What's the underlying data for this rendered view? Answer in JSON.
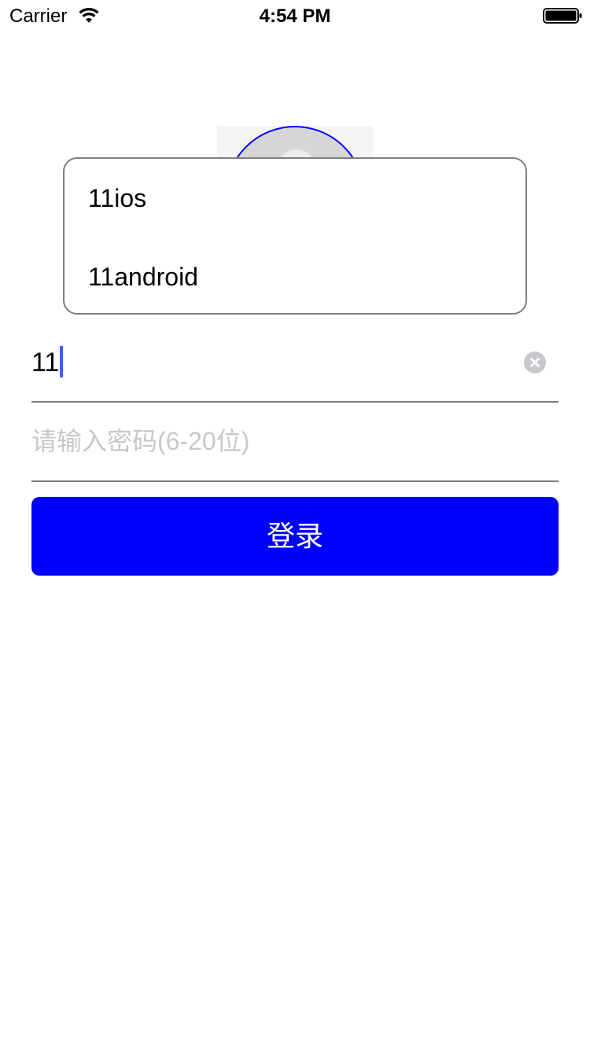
{
  "status_bar": {
    "carrier": "Carrier",
    "time": "4:54 PM",
    "icons": [
      "wifi-icon",
      "battery-icon"
    ]
  },
  "suggestions": {
    "items": [
      {
        "label": "11ios"
      },
      {
        "label": "11android"
      }
    ]
  },
  "account": {
    "value": "11",
    "clear_icon": "clear-circle-icon"
  },
  "password": {
    "placeholder": "请输入密码(6-20位)"
  },
  "login_button": {
    "label": "登录"
  },
  "colors": {
    "accent": "#0000ff",
    "caret": "#3b63f5",
    "placeholder": "#c7c7cd",
    "divider": "#7a7a7a"
  }
}
